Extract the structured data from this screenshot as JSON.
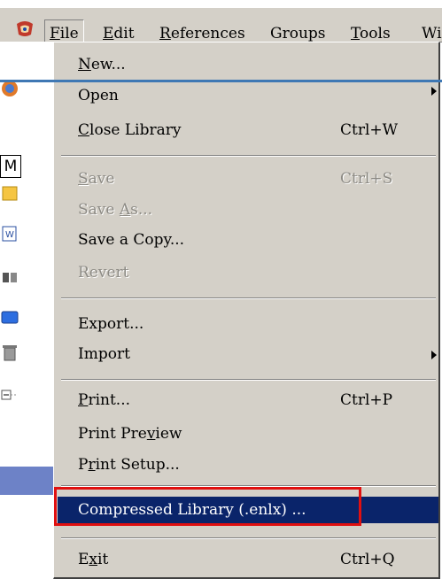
{
  "menubar": {
    "items": [
      {
        "label": "File",
        "ul": "F",
        "rest": "ile"
      },
      {
        "label": "Edit",
        "ul": "E",
        "rest": "dit"
      },
      {
        "label": "References",
        "ul": "R",
        "rest": "eferences"
      },
      {
        "label": "Groups"
      },
      {
        "label": "Tools",
        "ul": "T",
        "rest": "ools"
      },
      {
        "label": "Wi"
      }
    ]
  },
  "left_strip": {
    "tab_letter": "M"
  },
  "file_menu": {
    "items": {
      "new": {
        "ul": "N",
        "rest": "ew..."
      },
      "open": {
        "label": "Open"
      },
      "close_library": {
        "ul": "C",
        "rest": "lose Library",
        "shortcut": "Ctrl+W"
      },
      "save": {
        "ul": "S",
        "rest": "ave",
        "shortcut": "Ctrl+S"
      },
      "save_as": {
        "pre": "Save ",
        "ul": "A",
        "rest": "s..."
      },
      "save_copy": {
        "label": "Save a Copy..."
      },
      "revert": {
        "label": "Revert"
      },
      "export": {
        "label": "Export..."
      },
      "import": {
        "label": "Import"
      },
      "print": {
        "ul": "P",
        "rest": "rint...",
        "shortcut": "Ctrl+P"
      },
      "print_preview": {
        "pre": "Print Pre",
        "ul": "v",
        "rest": "iew"
      },
      "print_setup": {
        "pre": "P",
        "ul": "r",
        "rest": "int Setup..."
      },
      "compressed": {
        "label": "Compressed Library (.enlx) ..."
      },
      "exit": {
        "pre": "E",
        "ul": "x",
        "rest": "it",
        "shortcut": "Ctrl+Q"
      }
    }
  },
  "colors": {
    "menu_bg": "#d4d0c8",
    "highlight_bg": "#0a246a",
    "annotation_red": "#e01010",
    "annotation_blue": "#3f78b4"
  }
}
